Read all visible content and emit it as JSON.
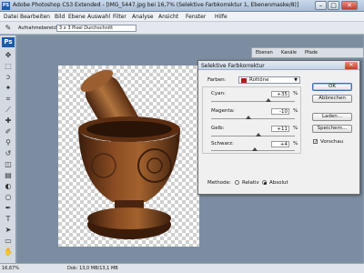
{
  "titlebar": {
    "app_icon": "PS",
    "title": "Adobe Photoshop CS3 Extended - [IMG_5447.jpg bei 16,7% (Selektive Farbkorrektur 1, Ebenenmaske/8)]"
  },
  "menu": [
    "Datei",
    "Bearbeiten",
    "Bild",
    "Ebene",
    "Auswahl",
    "Filter",
    "Analyse",
    "Ansicht",
    "Fenster",
    "Hilfe"
  ],
  "options": {
    "label": "Aufnahmebereich:",
    "value": "3 x 3 Pixel Durchschnitt"
  },
  "toolbox": {
    "logo": "Ps"
  },
  "panel": {
    "tabs": [
      "Ebenen",
      "Kanäle",
      "Pfade"
    ]
  },
  "status": {
    "zoom": "16,67%",
    "doc": "Dok: 13,0 MB/13,1 MB"
  },
  "dialog": {
    "title": "Selektive Farbkorrektur",
    "colors_label": "Farben:",
    "colors_value": "Rottöne",
    "colors_swatch": "#b01818",
    "sliders": [
      {
        "label": "Cyan:",
        "value": "+35",
        "unit": "%",
        "pos": 0.68
      },
      {
        "label": "Magenta:",
        "value": "-10",
        "unit": "%",
        "pos": 0.45
      },
      {
        "label": "Gelb:",
        "value": "+11",
        "unit": "%",
        "pos": 0.56
      },
      {
        "label": "Schwarz:",
        "value": "+4",
        "unit": "%",
        "pos": 0.52
      }
    ],
    "buttons": {
      "ok": "OK",
      "cancel": "Abbrechen",
      "load": "Laden...",
      "save": "Speichern..."
    },
    "preview_label": "Vorschau",
    "preview_checked": true,
    "method_label": "Methode:",
    "method_relative": "Relativ",
    "method_absolute": "Absolut",
    "method_selected": "Absolut"
  }
}
